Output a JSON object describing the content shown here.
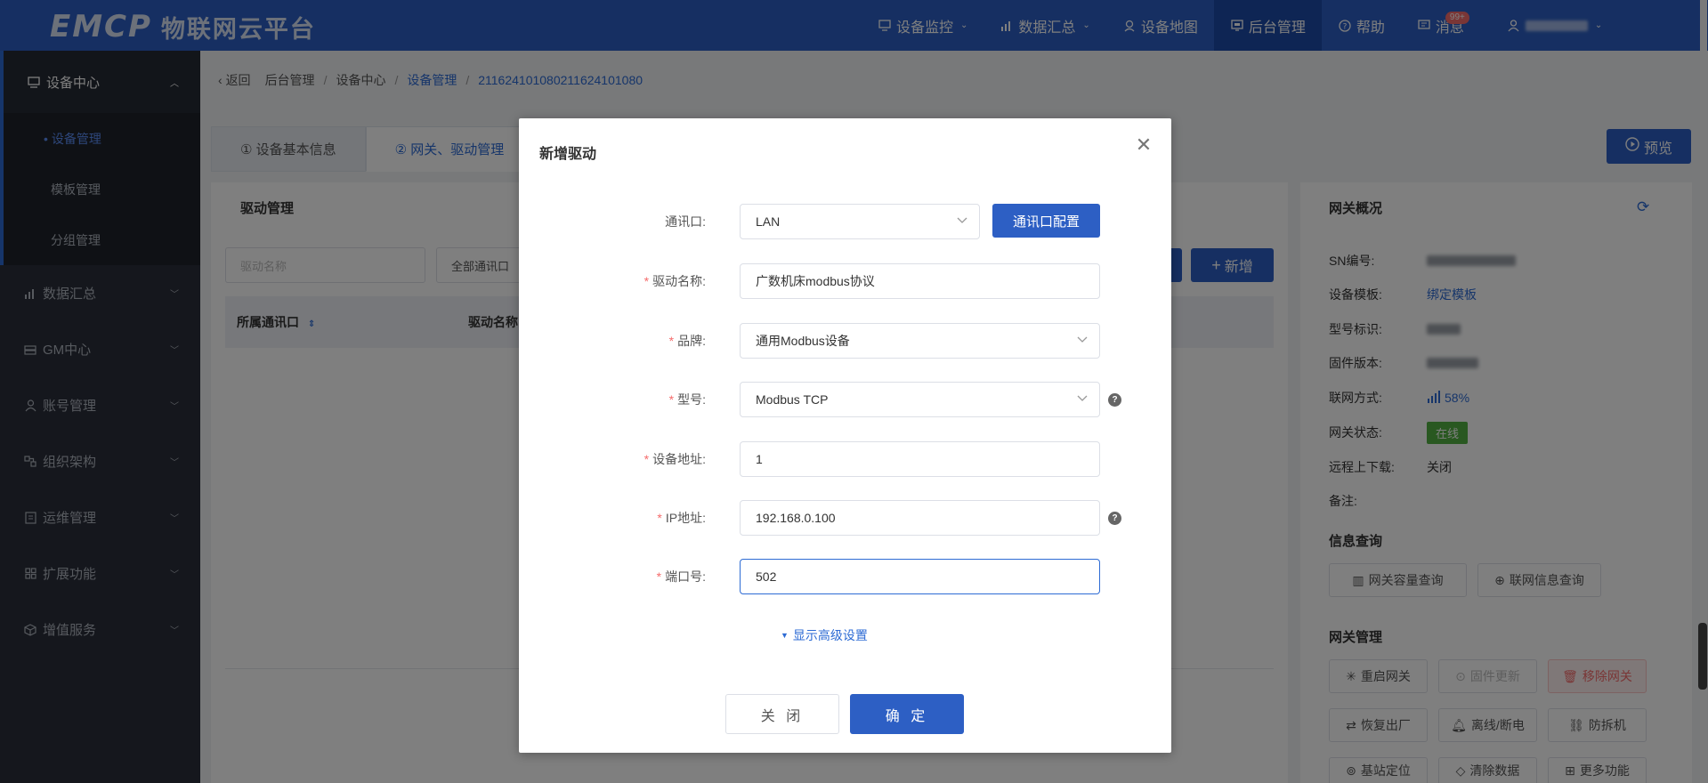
{
  "app": {
    "logo_main": "EMCP",
    "logo_sub": "物联网云平台"
  },
  "topnav": {
    "items": [
      {
        "label": "设备监控",
        "icon": "monitor-icon"
      },
      {
        "label": "数据汇总",
        "icon": "bar-chart-icon"
      },
      {
        "label": "设备地图",
        "icon": "map-pin-icon"
      },
      {
        "label": "后台管理",
        "icon": "dashboard-icon"
      },
      {
        "label": "帮助",
        "icon": "help-circle-icon"
      },
      {
        "label": "消息",
        "icon": "message-icon",
        "badge": "99+"
      }
    ]
  },
  "sidebar": {
    "group": {
      "label": "设备中心"
    },
    "subitems": [
      {
        "label": "设备管理"
      },
      {
        "label": "模板管理"
      },
      {
        "label": "分组管理"
      }
    ],
    "items": [
      {
        "label": "数据汇总"
      },
      {
        "label": "GM中心"
      },
      {
        "label": "账号管理"
      },
      {
        "label": "组织架构"
      },
      {
        "label": "运维管理"
      },
      {
        "label": "扩展功能"
      },
      {
        "label": "增值服务"
      }
    ]
  },
  "breadcrumb": {
    "back": "返回",
    "items": [
      "后台管理",
      "设备中心",
      "设备管理",
      "21162410108021162410108​0"
    ]
  },
  "tabs": [
    {
      "label": "① 设备基本信息"
    },
    {
      "label": "② 网关、驱动管理"
    }
  ],
  "preview_label": "预览",
  "driver_panel": {
    "title": "驱动管理",
    "filter_placeholder": "驱动名称",
    "filter_select": "全部通讯口",
    "new_button": "新增",
    "columns": [
      "所属通讯口",
      "驱动名称"
    ]
  },
  "gateway_panel": {
    "title": "网关概况",
    "fields": {
      "sn_label": "SN编号:",
      "template_label": "设备模板:",
      "template_value": "绑定模板",
      "model_label": "型号标识:",
      "firmware_label": "固件版本:",
      "network_label": "联网方式:",
      "network_value": "58%",
      "status_label": "网关状态:",
      "status_value": "在线",
      "remote_label": "远程上下载:",
      "remote_value": "关闭",
      "note_label": "备注:"
    },
    "info_title": "信息查询",
    "info_buttons": [
      "网关容量查询",
      "联网信息查询"
    ],
    "manage_title": "网关管理",
    "manage_buttons": [
      "重启网关",
      "固件更新",
      "移除网关",
      "恢复出厂",
      "离线/断电",
      "防拆机",
      "基站定位",
      "清除数据",
      "更多功能"
    ]
  },
  "dialog": {
    "title": "新增驱动",
    "fields": {
      "port": {
        "label": "通讯口:",
        "value": "LAN"
      },
      "port_config_button": "通讯口配置",
      "name": {
        "label": "驱动名称:",
        "value": "广数机床modbus协议"
      },
      "brand": {
        "label": "品牌:",
        "value": "通用Modbus设备"
      },
      "model": {
        "label": "型号:",
        "value": "Modbus TCP"
      },
      "address": {
        "label": "设备地址:",
        "value": "1"
      },
      "ip": {
        "label": "IP地址:",
        "value": "192.168.0.100"
      },
      "port_no": {
        "label": "端口号:",
        "value": "502"
      }
    },
    "advanced_link": "显示高级设置",
    "cancel_label": "关 闭",
    "ok_label": "确 定"
  }
}
